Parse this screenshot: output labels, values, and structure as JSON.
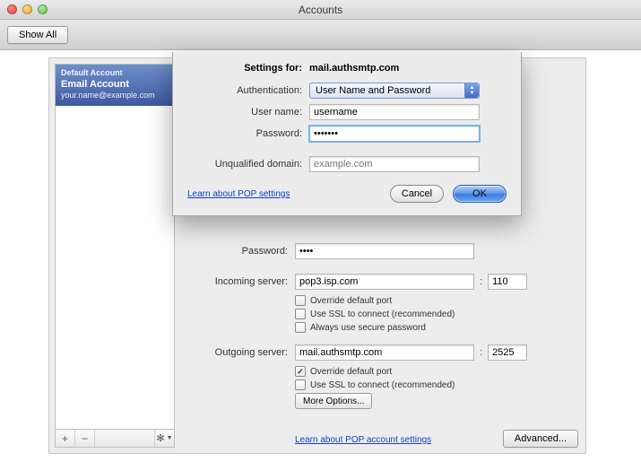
{
  "window": {
    "title": "Accounts"
  },
  "toolbar": {
    "show_all": "Show All"
  },
  "sidebar": {
    "account": {
      "type_label": "Default Account",
      "name": "Email Account",
      "email": "your.name@example.com"
    },
    "footer": {
      "add": "+",
      "remove": "−",
      "gear": "✻"
    }
  },
  "main": {
    "password_label": "Password:",
    "password_value": "••••",
    "incoming_label": "Incoming server:",
    "incoming_value": "pop3.isp.com",
    "incoming_port": "110",
    "outgoing_label": "Outgoing server:",
    "outgoing_value": "mail.authsmtp.com",
    "outgoing_port": "2525",
    "override_port": "Override default port",
    "use_ssl": "Use SSL to connect (recommended)",
    "secure_pwd": "Always use secure password",
    "more_options": "More Options...",
    "learn_link": "Learn about POP account settings",
    "advanced": "Advanced..."
  },
  "sheet": {
    "settings_for_label": "Settings for:",
    "server": "mail.authsmtp.com",
    "auth_label": "Authentication:",
    "auth_value": "User Name and Password",
    "user_label": "User name:",
    "user_value": "username",
    "pwd_label": "Password:",
    "pwd_value": "•••••••",
    "domain_label": "Unqualified domain:",
    "domain_placeholder": "example.com",
    "learn_link": "Learn about POP settings",
    "cancel": "Cancel",
    "ok": "OK"
  }
}
